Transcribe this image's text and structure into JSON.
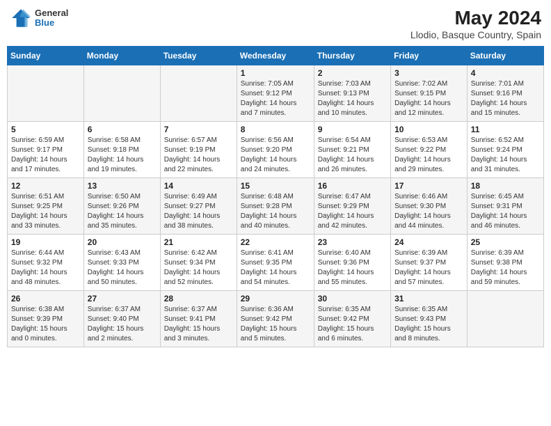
{
  "header": {
    "logo_general": "General",
    "logo_blue": "Blue",
    "title": "May 2024",
    "location": "Llodio, Basque Country, Spain"
  },
  "days_of_week": [
    "Sunday",
    "Monday",
    "Tuesday",
    "Wednesday",
    "Thursday",
    "Friday",
    "Saturday"
  ],
  "weeks": [
    [
      {
        "day": "",
        "content": ""
      },
      {
        "day": "",
        "content": ""
      },
      {
        "day": "",
        "content": ""
      },
      {
        "day": "1",
        "content": "Sunrise: 7:05 AM\nSunset: 9:12 PM\nDaylight: 14 hours\nand 7 minutes."
      },
      {
        "day": "2",
        "content": "Sunrise: 7:03 AM\nSunset: 9:13 PM\nDaylight: 14 hours\nand 10 minutes."
      },
      {
        "day": "3",
        "content": "Sunrise: 7:02 AM\nSunset: 9:15 PM\nDaylight: 14 hours\nand 12 minutes."
      },
      {
        "day": "4",
        "content": "Sunrise: 7:01 AM\nSunset: 9:16 PM\nDaylight: 14 hours\nand 15 minutes."
      }
    ],
    [
      {
        "day": "5",
        "content": "Sunrise: 6:59 AM\nSunset: 9:17 PM\nDaylight: 14 hours\nand 17 minutes."
      },
      {
        "day": "6",
        "content": "Sunrise: 6:58 AM\nSunset: 9:18 PM\nDaylight: 14 hours\nand 19 minutes."
      },
      {
        "day": "7",
        "content": "Sunrise: 6:57 AM\nSunset: 9:19 PM\nDaylight: 14 hours\nand 22 minutes."
      },
      {
        "day": "8",
        "content": "Sunrise: 6:56 AM\nSunset: 9:20 PM\nDaylight: 14 hours\nand 24 minutes."
      },
      {
        "day": "9",
        "content": "Sunrise: 6:54 AM\nSunset: 9:21 PM\nDaylight: 14 hours\nand 26 minutes."
      },
      {
        "day": "10",
        "content": "Sunrise: 6:53 AM\nSunset: 9:22 PM\nDaylight: 14 hours\nand 29 minutes."
      },
      {
        "day": "11",
        "content": "Sunrise: 6:52 AM\nSunset: 9:24 PM\nDaylight: 14 hours\nand 31 minutes."
      }
    ],
    [
      {
        "day": "12",
        "content": "Sunrise: 6:51 AM\nSunset: 9:25 PM\nDaylight: 14 hours\nand 33 minutes."
      },
      {
        "day": "13",
        "content": "Sunrise: 6:50 AM\nSunset: 9:26 PM\nDaylight: 14 hours\nand 35 minutes."
      },
      {
        "day": "14",
        "content": "Sunrise: 6:49 AM\nSunset: 9:27 PM\nDaylight: 14 hours\nand 38 minutes."
      },
      {
        "day": "15",
        "content": "Sunrise: 6:48 AM\nSunset: 9:28 PM\nDaylight: 14 hours\nand 40 minutes."
      },
      {
        "day": "16",
        "content": "Sunrise: 6:47 AM\nSunset: 9:29 PM\nDaylight: 14 hours\nand 42 minutes."
      },
      {
        "day": "17",
        "content": "Sunrise: 6:46 AM\nSunset: 9:30 PM\nDaylight: 14 hours\nand 44 minutes."
      },
      {
        "day": "18",
        "content": "Sunrise: 6:45 AM\nSunset: 9:31 PM\nDaylight: 14 hours\nand 46 minutes."
      }
    ],
    [
      {
        "day": "19",
        "content": "Sunrise: 6:44 AM\nSunset: 9:32 PM\nDaylight: 14 hours\nand 48 minutes."
      },
      {
        "day": "20",
        "content": "Sunrise: 6:43 AM\nSunset: 9:33 PM\nDaylight: 14 hours\nand 50 minutes."
      },
      {
        "day": "21",
        "content": "Sunrise: 6:42 AM\nSunset: 9:34 PM\nDaylight: 14 hours\nand 52 minutes."
      },
      {
        "day": "22",
        "content": "Sunrise: 6:41 AM\nSunset: 9:35 PM\nDaylight: 14 hours\nand 54 minutes."
      },
      {
        "day": "23",
        "content": "Sunrise: 6:40 AM\nSunset: 9:36 PM\nDaylight: 14 hours\nand 55 minutes."
      },
      {
        "day": "24",
        "content": "Sunrise: 6:39 AM\nSunset: 9:37 PM\nDaylight: 14 hours\nand 57 minutes."
      },
      {
        "day": "25",
        "content": "Sunrise: 6:39 AM\nSunset: 9:38 PM\nDaylight: 14 hours\nand 59 minutes."
      }
    ],
    [
      {
        "day": "26",
        "content": "Sunrise: 6:38 AM\nSunset: 9:39 PM\nDaylight: 15 hours\nand 0 minutes."
      },
      {
        "day": "27",
        "content": "Sunrise: 6:37 AM\nSunset: 9:40 PM\nDaylight: 15 hours\nand 2 minutes."
      },
      {
        "day": "28",
        "content": "Sunrise: 6:37 AM\nSunset: 9:41 PM\nDaylight: 15 hours\nand 3 minutes."
      },
      {
        "day": "29",
        "content": "Sunrise: 6:36 AM\nSunset: 9:42 PM\nDaylight: 15 hours\nand 5 minutes."
      },
      {
        "day": "30",
        "content": "Sunrise: 6:35 AM\nSunset: 9:42 PM\nDaylight: 15 hours\nand 6 minutes."
      },
      {
        "day": "31",
        "content": "Sunrise: 6:35 AM\nSunset: 9:43 PM\nDaylight: 15 hours\nand 8 minutes."
      },
      {
        "day": "",
        "content": ""
      }
    ]
  ]
}
